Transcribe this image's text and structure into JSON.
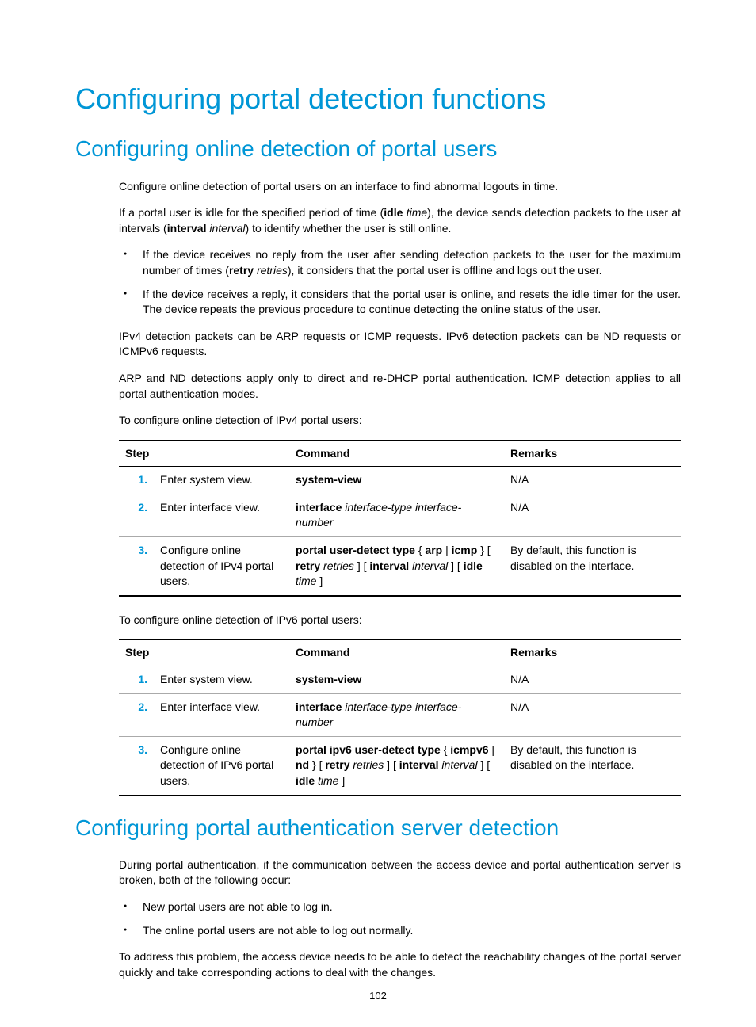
{
  "h1": "Configuring portal detection functions",
  "h2a": "Configuring online detection of portal users",
  "p1": "Configure online detection of portal users on an interface to find abnormal logouts in time.",
  "p2_a": "If a portal user is idle for the specified period of time (",
  "p2_b": "idle",
  "p2_c": " time",
  "p2_d": "), the device sends detection packets to the user at intervals (",
  "p2_e": "interval",
  "p2_f": " interval",
  "p2_g": ") to identify whether the user is still online.",
  "b1_a": "If the device receives no reply from the user after sending detection packets to the user for the maximum number of times (",
  "b1_b": "retry",
  "b1_c": " retries",
  "b1_d": "), it considers that the portal user is offline and logs out the user.",
  "b2": "If the device receives a reply, it considers that the portal user is online, and resets the idle timer for the user. The device repeats the previous procedure to continue detecting the online status of the user.",
  "p3": "IPv4 detection packets can be ARP requests or ICMP requests. IPv6 detection packets can be ND requests or ICMPv6 requests.",
  "p4": "ARP and ND detections apply only to direct and re-DHCP portal authentication. ICMP detection applies to all portal authentication modes.",
  "p5": "To configure online detection of IPv4 portal users:",
  "headers": {
    "step": "Step",
    "cmd": "Command",
    "rem": "Remarks"
  },
  "t1": {
    "r1": {
      "num": "1.",
      "step": "Enter system view.",
      "cmd_bold": "system-view",
      "rem": "N/A"
    },
    "r2": {
      "num": "2.",
      "step": "Enter interface view.",
      "cmd_bold": "interface",
      "cmd_it": " interface-type interface-number",
      "rem": "N/A"
    },
    "r3": {
      "num": "3.",
      "step": "Configure online detection of IPv4 portal users.",
      "seg1": "portal user-detect type",
      "seg2": " { ",
      "seg3": "arp",
      "seg4": " | ",
      "seg5": "icmp",
      "seg6": " } [ ",
      "seg7": "retry",
      "seg8": " retries",
      "seg9": " ] [ ",
      "seg10": "interval",
      "seg11": " interval",
      "seg12": " ] [ ",
      "seg13": "idle",
      "seg14": " time",
      "seg15": " ]",
      "rem": "By default, this function is disabled on the interface."
    }
  },
  "p6": "To configure online detection of IPv6 portal users:",
  "t2": {
    "r1": {
      "num": "1.",
      "step": "Enter system view.",
      "cmd_bold": "system-view",
      "rem": "N/A"
    },
    "r2": {
      "num": "2.",
      "step": "Enter interface view.",
      "cmd_bold": "interface",
      "cmd_it": " interface-type interface-number",
      "rem": "N/A"
    },
    "r3": {
      "num": "3.",
      "step": "Configure online detection of IPv6 portal users.",
      "seg1": "portal ipv6 user-detect type",
      "seg2": " { ",
      "seg3": "icmpv6",
      "seg4": " | ",
      "seg5": "nd",
      "seg6": " } [ ",
      "seg7": "retry",
      "seg8": " retries",
      "seg9": " ] [ ",
      "seg10": "interval",
      "seg11": " interval",
      "seg12": " ] [ ",
      "seg13": "idle",
      "seg14": " time",
      "seg15": " ]",
      "rem": "By default, this function is disabled on the interface."
    }
  },
  "h2b": "Configuring portal authentication server detection",
  "p7": "During portal authentication, if the communication between the access device and portal authentication server is broken, both of the following occur:",
  "b3": "New portal users are not able to log in.",
  "b4": "The online portal users are not able to log out normally.",
  "p8": "To address this problem, the access device needs to be able to detect the reachability changes of the portal server quickly and take corresponding actions to deal with the changes.",
  "pagenum": "102"
}
